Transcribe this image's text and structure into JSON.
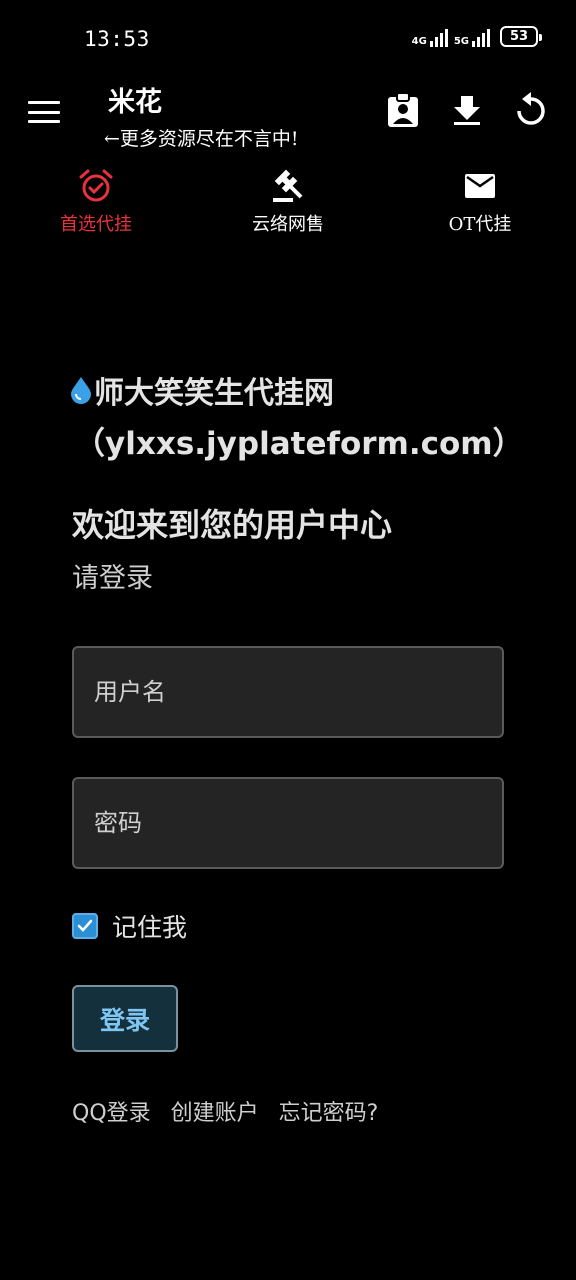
{
  "status": {
    "time": "13:53",
    "network1": "4G",
    "network2": "5G",
    "battery": "53"
  },
  "appbar": {
    "title": "米花",
    "subtitle": "←更多资源尽在不言中!",
    "icons": [
      "menu-icon",
      "contact-clipboard-icon",
      "download-icon",
      "refresh-icon"
    ]
  },
  "tabs": [
    {
      "label": "首选代挂",
      "icon": "alarm-icon",
      "active": true
    },
    {
      "label": "云络网售",
      "icon": "gavel-icon",
      "active": false
    },
    {
      "label": "OT代挂",
      "icon": "mail-icon",
      "active": false
    }
  ],
  "main": {
    "site_title": "师大笑笑生代挂网",
    "site_url": "（ylxxs.jyplateform.com）",
    "welcome": "欢迎来到您的用户中心",
    "please_login": "请登录",
    "username_placeholder": "用户名",
    "password_placeholder": "密码",
    "remember_label": "记住我",
    "remember_checked": true,
    "login_button": "登录",
    "links": [
      "QQ登录",
      "创建账户",
      "忘记密码?"
    ]
  },
  "colors": {
    "background": "#000000",
    "accent_red": "#e8323c",
    "button_text": "#7fc6f2",
    "checkbox": "#2b8fd6"
  }
}
